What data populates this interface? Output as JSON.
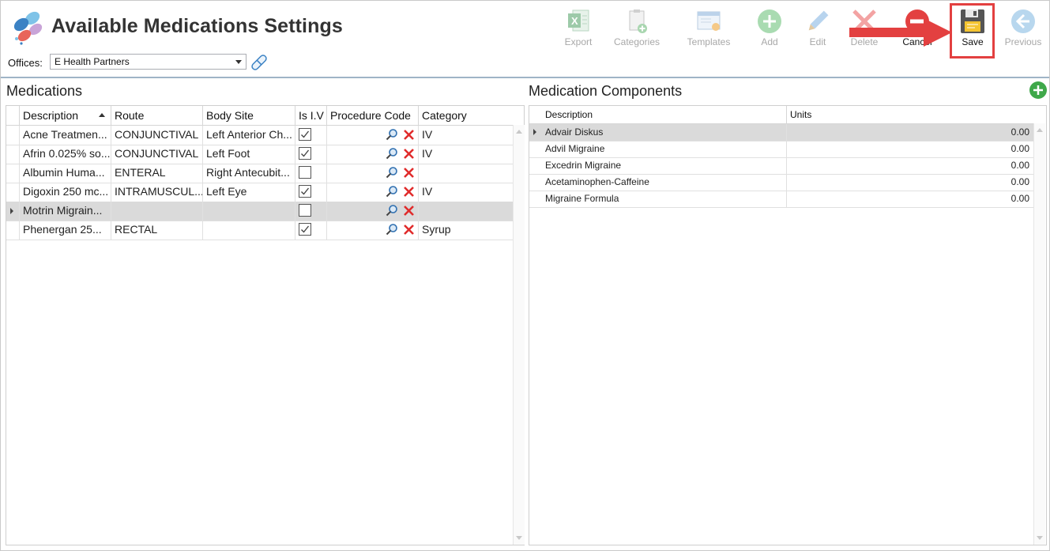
{
  "header": {
    "title": "Available Medications Settings",
    "offices_label": "Offices:",
    "offices_value": "E Health Partners"
  },
  "toolbar": {
    "export": "Export",
    "categories": "Categories",
    "templates": "Templates",
    "add": "Add",
    "edit": "Edit",
    "delete": "Delete",
    "cancel": "Cancel",
    "save": "Save",
    "previous": "Previous"
  },
  "medications": {
    "title": "Medications",
    "columns": [
      "Description",
      "Route",
      "Body Site",
      "Is I.V",
      "Procedure Code",
      "Category"
    ],
    "rows": [
      {
        "description": "Acne Treatmen...",
        "route": "CONJUNCTIVAL",
        "body_site": "Left Anterior Ch...",
        "is_iv": true,
        "category": "IV"
      },
      {
        "description": "Afrin 0.025% so...",
        "route": "CONJUNCTIVAL",
        "body_site": "Left Foot",
        "is_iv": true,
        "category": "IV"
      },
      {
        "description": "Albumin Huma...",
        "route": "ENTERAL",
        "body_site": "Right Antecubit...",
        "is_iv": false,
        "category": ""
      },
      {
        "description": "Digoxin 250 mc...",
        "route": "INTRAMUSCUL...",
        "body_site": "Left Eye",
        "is_iv": true,
        "category": "IV"
      },
      {
        "description": "Motrin Migrain...",
        "route": "",
        "body_site": "",
        "is_iv": false,
        "category": ""
      },
      {
        "description": "Phenergan 25...",
        "route": "RECTAL",
        "body_site": "",
        "is_iv": true,
        "category": "Syrup"
      }
    ]
  },
  "components": {
    "title": "Medication Components",
    "columns": [
      "Description",
      "Units"
    ],
    "rows": [
      {
        "description": "Advair Diskus",
        "units": "0.00"
      },
      {
        "description": "Advil Migraine",
        "units": "0.00"
      },
      {
        "description": "Excedrin Migraine",
        "units": "0.00"
      },
      {
        "description": "Acetaminophen-Caffeine",
        "units": "0.00"
      },
      {
        "description": "Migraine Formula",
        "units": "0.00"
      }
    ]
  },
  "colors": {
    "accent_red": "#e34040",
    "add_green": "#3fa84a",
    "header_rule": "#9fb4c6",
    "selected_row": "#dadada"
  },
  "icons": [
    "logo-icon",
    "excel-export-icon",
    "categories-icon",
    "templates-icon",
    "add-icon",
    "edit-pencil-icon",
    "delete-x-icon",
    "cancel-icon",
    "save-disk-icon",
    "previous-arrow-icon",
    "edit-office-icon",
    "procedure-search-icon",
    "remove-x-icon",
    "add-component-icon"
  ]
}
